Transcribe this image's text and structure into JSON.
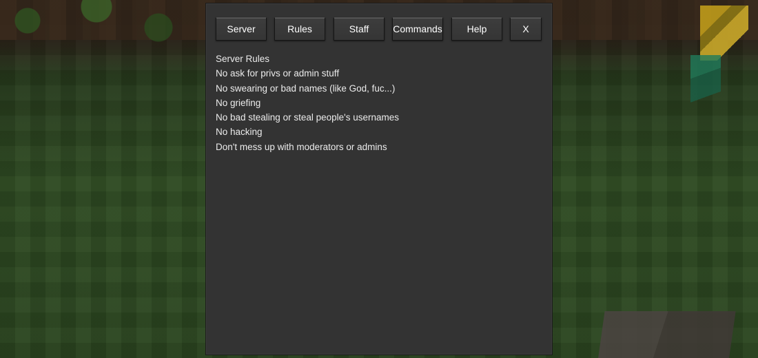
{
  "tabs": {
    "server": "Server",
    "rules": "Rules",
    "staff": "Staff",
    "commands": "Commands",
    "help": "Help",
    "close": "X"
  },
  "content": {
    "title": "Server Rules",
    "lines": [
      "No ask for privs or admin stuff",
      "No swearing or bad names (like God, fuc...)",
      "No griefing",
      "No bad stealing or steal people's usernames",
      "No hacking",
      "Don't mess up with moderators or admins"
    ]
  },
  "colors": {
    "dialog_bg": "#333333",
    "button_bg": "#3a3a3a",
    "text": "#ececec"
  }
}
